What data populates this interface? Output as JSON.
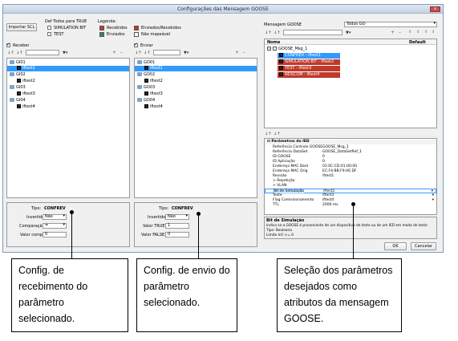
{
  "window": {
    "title": "Configurações das Mensagem GOOSE",
    "close": "x"
  },
  "top": {
    "import_button": "Importar SCL",
    "def_true_title": "Def Todos para TRUE",
    "simulation_bit": "SIMULATION BIT",
    "test": "TEST",
    "legend_title": "Legenda:",
    "legend_received": "Recebidos",
    "legend_sent": "Enviados",
    "legend_sent_received": "Enviados/Recebidos",
    "legend_not_mapped": "Não mapeável",
    "colors": {
      "received": "#c0392b",
      "sent": "#2e8b57",
      "sent_received": "#c0392b",
      "not_mapped": "#ffffff"
    }
  },
  "receive_panel": {
    "checkbox": "Receber",
    "items": [
      {
        "label": "GI01",
        "type": "group"
      },
      {
        "label": "iftest1",
        "type": "item",
        "selected": true
      },
      {
        "label": "GI02",
        "type": "group"
      },
      {
        "label": "iftest2",
        "type": "item"
      },
      {
        "label": "GI03",
        "type": "group"
      },
      {
        "label": "iftest3",
        "type": "item"
      },
      {
        "label": "GI04",
        "type": "group"
      },
      {
        "label": "iftest4",
        "type": "item"
      }
    ],
    "config": {
      "tipo_label": "Tipo:",
      "tipo_value": "CONFREV",
      "invertido_label": "Invertido:",
      "invertido_value": "Não",
      "comparacao_label": "Comparação:",
      "comparacao_value": "=",
      "valor_comp_label": "Valor comp.:",
      "valor_comp_value": "0"
    }
  },
  "send_panel": {
    "checkbox": "Enviar",
    "items": [
      {
        "label": "GO01",
        "type": "group"
      },
      {
        "label": "iftest1",
        "type": "item",
        "selected": true
      },
      {
        "label": "GO02",
        "type": "group"
      },
      {
        "label": "iftest2",
        "type": "item"
      },
      {
        "label": "GO03",
        "type": "group"
      },
      {
        "label": "iftest3",
        "type": "item"
      },
      {
        "label": "GO04",
        "type": "group"
      },
      {
        "label": "iftest4",
        "type": "item"
      }
    ],
    "config": {
      "tipo_label": "Tipo:",
      "tipo_value": "CONFREV",
      "invertido_label": "Invertido:",
      "invertido_value": "Não",
      "true_label": "Valor TRUE:",
      "true_value": "1",
      "false_label": "Valor FALSE:",
      "false_value": "0"
    }
  },
  "goose_panel": {
    "label": "Mensagem GOOSE",
    "dropdown_value": "Todos GO",
    "col_name": "Nome",
    "col_default": "Default",
    "root": "GOOSE_Msg_1",
    "children": [
      {
        "label": "CONFREV - iftest1",
        "style": "selected"
      },
      {
        "label": "SIMULATION BIT - iftest2",
        "style": "received"
      },
      {
        "label": "TEST - iftest3",
        "style": "received"
      },
      {
        "label": "NDSCOM - iftest4",
        "style": "received"
      }
    ]
  },
  "properties": {
    "section": "Parâmetros do IED",
    "rows": [
      {
        "k": "Referência Controle GOOSE",
        "v": "GOOSE_Msg_1"
      },
      {
        "k": "Referência DataSet",
        "v": "GOOSE_DataSetRef_1"
      },
      {
        "k": "ID GOOSE",
        "v": "0"
      },
      {
        "k": "ID Aplicação",
        "v": "0"
      },
      {
        "k": "Endereço MAC Dest",
        "v": "01:0C:CD:01:00:00"
      },
      {
        "k": "Endereço MAC Orig",
        "v": "EC:F4:BB:F9:AE:DF"
      },
      {
        "k": "Revisão",
        "v": "iftest1"
      },
      {
        "k": "> Repetição",
        "v": ""
      },
      {
        "k": "> VLAN",
        "v": ""
      },
      {
        "k": "Bit de Simulação",
        "v": "iftest2",
        "highlight": true
      },
      {
        "k": "Teste",
        "v": "iftest3"
      },
      {
        "k": "Flag Comissionamento",
        "v": "iftest4"
      },
      {
        "k": "TTL",
        "v": "2000 ms"
      }
    ],
    "desc_title": "Bit de Simulação",
    "desc_text": "Indica se a GOOSE é proveniente de um dispositivo de teste ou de um IED em modo de teste",
    "desc_type": "Tipo: Booleana",
    "desc_limits": "Limite Inf.:>= 0"
  },
  "footer": {
    "ok": "OK",
    "cancel": "Cancelar"
  },
  "callouts": {
    "left": "Config. de recebimento do parâmetro selecionado.",
    "middle": "Config. de envio do parâmetro selecionado.",
    "right": "Seleção dos parâmetros desejados como atributos da mensagem GOOSE."
  }
}
